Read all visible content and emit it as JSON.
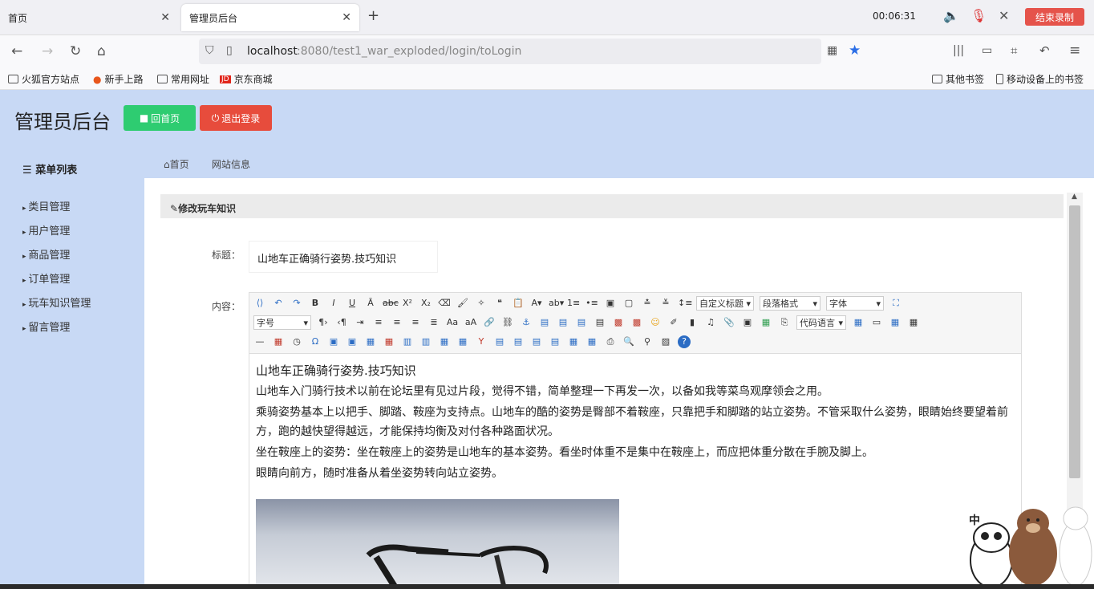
{
  "browser": {
    "tabs": [
      {
        "title": "首页"
      },
      {
        "title": "管理员后台"
      }
    ],
    "timer": "00:06:31",
    "stop_recording": "结束录制",
    "url_host": "localhost",
    "url_rest": ":8080/test1_war_exploded/login/toLogin",
    "bookmarks": [
      "火狐官方站点",
      "新手上路",
      "常用网址",
      "京东商城"
    ],
    "other_bookmarks": "其他书签",
    "mobile_bookmarks": "移动设备上的书签"
  },
  "admin": {
    "title": "管理员后台",
    "home_button": "回首页",
    "logout_button": "退出登录",
    "menu_title": "菜单列表",
    "menu_items": [
      "类目管理",
      "用户管理",
      "商品管理",
      "订单管理",
      "玩车知识管理",
      "留言管理"
    ],
    "breadcrumbs": [
      "首页",
      "网站信息"
    ]
  },
  "form": {
    "panel_title": "修改玩车知识",
    "title_label": "标题：",
    "title_value": "山地车正确骑行姿势.技巧知识",
    "content_label": "内容：",
    "toolbar": {
      "custom_title": "自定义标题",
      "paragraph": "段落格式",
      "font": "字体",
      "font_size": "字号",
      "code_lang": "代码语言"
    },
    "content_lines": [
      "山地车正确骑行姿势.技巧知识",
      "山地车入门骑行技术以前在论坛里有见过片段，觉得不错，简单整理一下再发一次，以备如我等菜鸟观摩领会之用。",
      "乘骑姿势基本上以把手、脚踏、鞍座为支持点。山地车的酷的姿势是臀部不着鞍座，只靠把手和脚踏的站立姿势。不管采取什么姿势，眼睛始终要望着前方，跑的越快望得越远，才能保持均衡及对付各种路面状况。",
      "坐在鞍座上的姿势：坐在鞍座上的姿势是山地车的基本姿势。看坐时体重不是集中在鞍座上，而应把体重分散在手腕及脚上。",
      "眼睛向前方，随时准备从着坐姿势转向站立姿势。"
    ]
  },
  "decor": {
    "bear_text": "中"
  }
}
